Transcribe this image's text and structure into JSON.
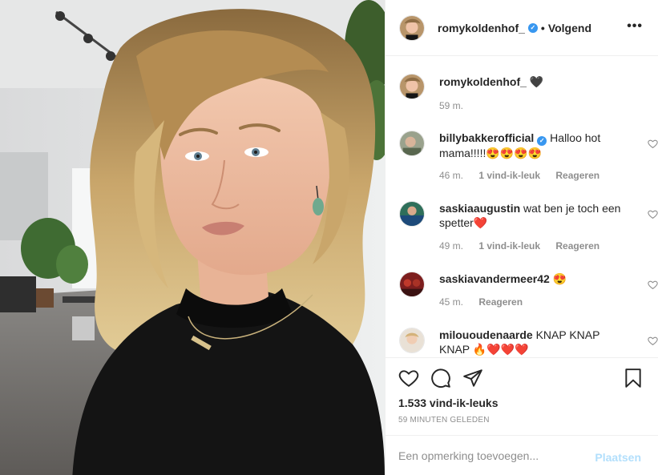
{
  "post": {
    "author": "romykoldenhof_",
    "separator": "•",
    "follow_label": "Volgend",
    "more_label": "•••",
    "verified_mark": "✓"
  },
  "caption": {
    "user": "romykoldenhof_",
    "text": "🖤",
    "age": "59 m."
  },
  "comments": [
    {
      "user": "billybakkerofficial",
      "verified": true,
      "text": "Halloo hot mama!!!!!😍😍😍😍",
      "age": "46 m.",
      "likes": "1 vind-ik-leuk",
      "reply": "Reageren"
    },
    {
      "user": "saskiaaugustin",
      "verified": false,
      "text": "wat ben je toch een spetter❤️",
      "age": "49 m.",
      "likes": "1 vind-ik-leuk",
      "reply": "Reageren"
    },
    {
      "user": "saskiavandermeer42",
      "verified": false,
      "text": "😍",
      "age": "45 m.",
      "reply": "Reageren"
    },
    {
      "user": "milououdenaarde",
      "verified": false,
      "text": "KNAP KNAP KNAP 🔥❤️❤️❤️"
    }
  ],
  "stats": {
    "likes": "1.533 vind-ik-leuks",
    "time": "59 MINUTEN GELEDEN"
  },
  "composer": {
    "placeholder": "Een opmerking toevoegen...",
    "submit": "Plaatsen"
  },
  "colors": {
    "accent": "#3897f0",
    "submit_disabled": "#b2dffc",
    "muted": "#8e8e8e",
    "text": "#262626"
  },
  "icons": [
    "heart-icon",
    "comment-icon",
    "share-icon",
    "bookmark-icon",
    "verified-badge-icon",
    "more-icon"
  ]
}
